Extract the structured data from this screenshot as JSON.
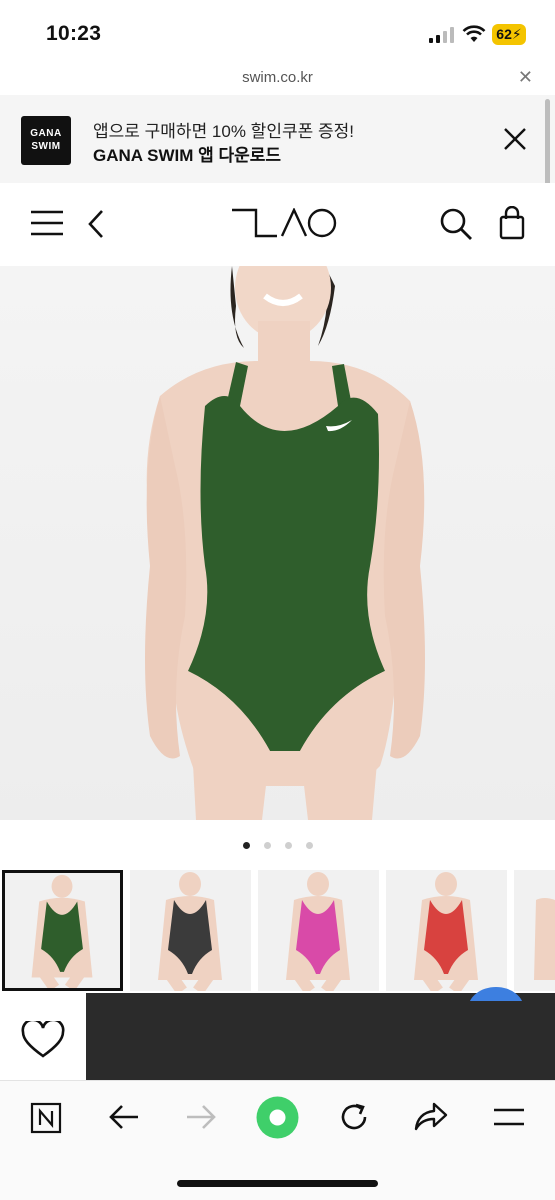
{
  "status": {
    "time": "10:23",
    "battery": "62"
  },
  "browser": {
    "url": "swim.co.kr",
    "close_icon": "close-icon"
  },
  "app_banner": {
    "logo_line1": "GANA",
    "logo_line2": "SWIM",
    "line1": "앱으로 구매하면 10% 할인쿠폰 증정!",
    "line2": "GANA SWIM 앱 다운로드"
  },
  "header": {
    "logo": "LAO"
  },
  "product": {
    "colors": {
      "main": "#2f5e2c",
      "thumb_1": "#2f5e2c",
      "thumb_2": "#3b3b3b",
      "thumb_3": "#d94aa8",
      "thumb_4": "#d8423f"
    },
    "carousel": {
      "count": 4,
      "active": 0
    }
  },
  "colors": {
    "accent": "#3fcf6a",
    "dark_bar": "#2b2b2b"
  }
}
